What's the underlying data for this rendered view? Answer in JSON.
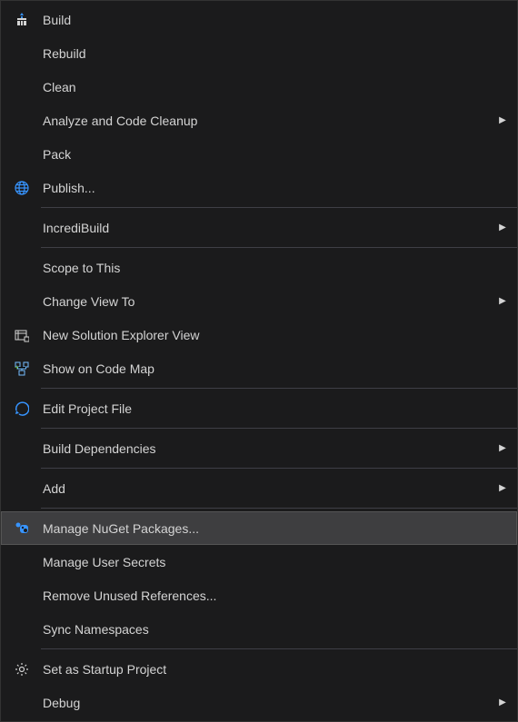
{
  "menu": {
    "items": [
      {
        "id": "build",
        "label": "Build",
        "icon": "build-icon",
        "submenu": false
      },
      {
        "id": "rebuild",
        "label": "Rebuild",
        "icon": null,
        "submenu": false
      },
      {
        "id": "clean",
        "label": "Clean",
        "icon": null,
        "submenu": false
      },
      {
        "id": "analyze",
        "label": "Analyze and Code Cleanup",
        "icon": null,
        "submenu": true
      },
      {
        "id": "pack",
        "label": "Pack",
        "icon": null,
        "submenu": false
      },
      {
        "id": "publish",
        "label": "Publish...",
        "icon": "publish-icon",
        "submenu": false
      },
      {
        "separator": true
      },
      {
        "id": "incredibuild",
        "label": "IncrediBuild",
        "icon": null,
        "submenu": true
      },
      {
        "separator": true
      },
      {
        "id": "scope",
        "label": "Scope to This",
        "icon": null,
        "submenu": false
      },
      {
        "id": "changeview",
        "label": "Change View To",
        "icon": null,
        "submenu": true
      },
      {
        "id": "newsolution",
        "label": "New Solution Explorer View",
        "icon": "solution-icon",
        "submenu": false
      },
      {
        "id": "codemap",
        "label": "Show on Code Map",
        "icon": "codemap-icon",
        "submenu": false
      },
      {
        "separator": true
      },
      {
        "id": "editproject",
        "label": "Edit Project File",
        "icon": "edit-icon",
        "submenu": false
      },
      {
        "separator": true
      },
      {
        "id": "builddeps",
        "label": "Build Dependencies",
        "icon": null,
        "submenu": true
      },
      {
        "separator": true
      },
      {
        "id": "add",
        "label": "Add",
        "icon": null,
        "submenu": true
      },
      {
        "separator": true
      },
      {
        "id": "nuget",
        "label": "Manage NuGet Packages...",
        "icon": "nuget-icon",
        "submenu": false,
        "highlighted": true
      },
      {
        "id": "usersecrets",
        "label": "Manage User Secrets",
        "icon": null,
        "submenu": false
      },
      {
        "id": "removeunused",
        "label": "Remove Unused References...",
        "icon": null,
        "submenu": false
      },
      {
        "id": "syncns",
        "label": "Sync Namespaces",
        "icon": null,
        "submenu": false
      },
      {
        "separator": true
      },
      {
        "id": "startup",
        "label": "Set as Startup Project",
        "icon": "gear-icon",
        "submenu": false
      },
      {
        "id": "debug",
        "label": "Debug",
        "icon": null,
        "submenu": true
      }
    ]
  }
}
